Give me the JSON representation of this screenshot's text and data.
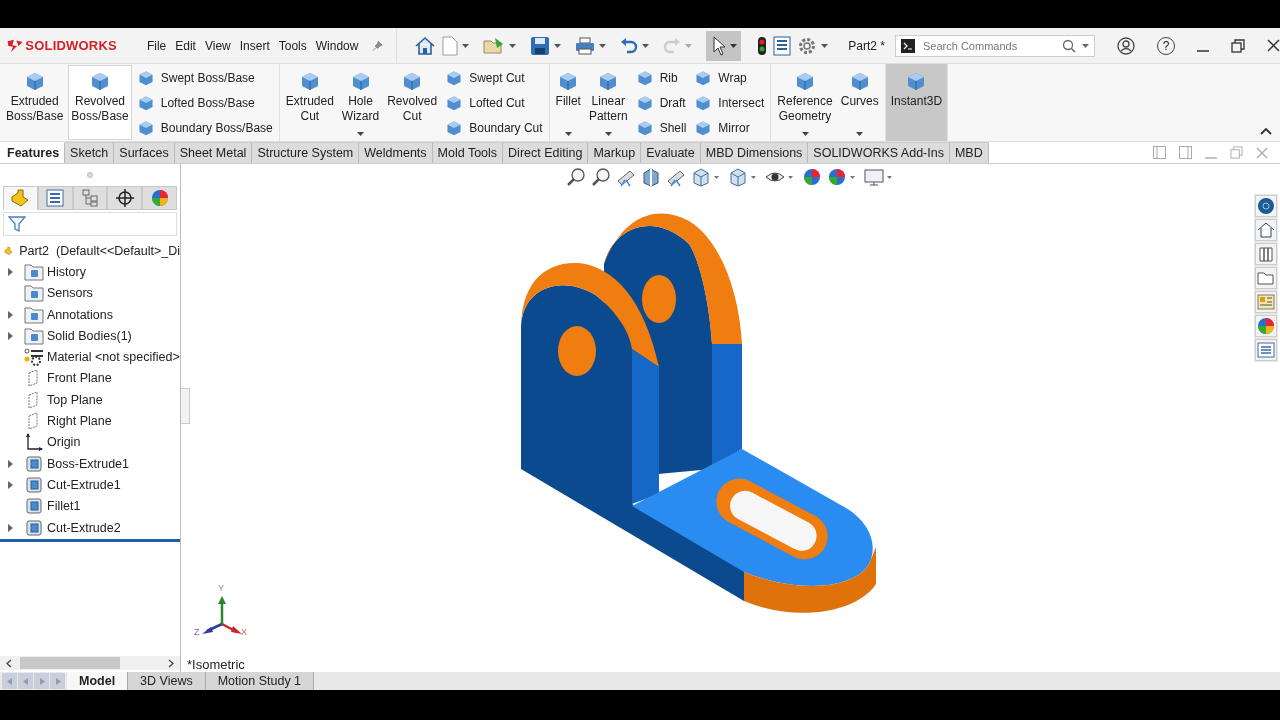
{
  "app": {
    "logo": "SOLIDWORKS"
  },
  "menu": [
    {
      "label": "File"
    },
    {
      "label": "Edit"
    },
    {
      "label": "View"
    },
    {
      "label": "Insert"
    },
    {
      "label": "Tools"
    },
    {
      "label": "Window"
    }
  ],
  "document_title": "Part2 *",
  "search": {
    "placeholder": "Search Commands"
  },
  "help": "?",
  "ribbon": [
    {
      "items": [
        {
          "kind": "large",
          "label": "Extruded Boss/Base",
          "hovered": false,
          "pressed": false,
          "has_menu": false
        },
        {
          "kind": "large",
          "label": "Revolved Boss/Base",
          "hovered": true,
          "pressed": false,
          "has_menu": false
        },
        {
          "kind": "stack",
          "items": [
            {
              "label": "Swept Boss/Base"
            },
            {
              "label": "Lofted Boss/Base"
            },
            {
              "label": "Boundary Boss/Base"
            }
          ]
        }
      ]
    },
    {
      "items": [
        {
          "kind": "large",
          "label": "Extruded Cut",
          "hovered": false,
          "pressed": false,
          "has_menu": false
        },
        {
          "kind": "large",
          "label": "Hole Wizard",
          "hovered": false,
          "pressed": false,
          "has_menu": true
        },
        {
          "kind": "large",
          "label": "Revolved Cut",
          "hovered": false,
          "pressed": false,
          "has_menu": false
        },
        {
          "kind": "stack",
          "items": [
            {
              "label": "Swept Cut"
            },
            {
              "label": "Lofted Cut"
            },
            {
              "label": "Boundary Cut"
            }
          ]
        }
      ]
    },
    {
      "items": [
        {
          "kind": "large",
          "label": "Fillet",
          "hovered": false,
          "pressed": false,
          "has_menu": true
        },
        {
          "kind": "large",
          "label": "Linear Pattern",
          "hovered": false,
          "pressed": false,
          "has_menu": true
        },
        {
          "kind": "stack",
          "items": [
            {
              "label": "Rib"
            },
            {
              "label": "Draft"
            },
            {
              "label": "Shell"
            }
          ]
        },
        {
          "kind": "stack",
          "items": [
            {
              "label": "Wrap"
            },
            {
              "label": "Intersect"
            },
            {
              "label": "Mirror"
            }
          ]
        }
      ]
    },
    {
      "items": [
        {
          "kind": "large",
          "label": "Reference Geometry",
          "hovered": false,
          "pressed": false,
          "has_menu": true
        },
        {
          "kind": "large",
          "label": "Curves",
          "hovered": false,
          "pressed": false,
          "has_menu": true
        }
      ]
    },
    {
      "items": [
        {
          "kind": "large",
          "label": "Instant3D",
          "hovered": false,
          "pressed": true,
          "has_menu": false
        }
      ]
    }
  ],
  "tabs": [
    {
      "label": "Features",
      "selected": true
    },
    {
      "label": "Sketch",
      "selected": false
    },
    {
      "label": "Surfaces",
      "selected": false
    },
    {
      "label": "Sheet Metal",
      "selected": false
    },
    {
      "label": "Structure System",
      "selected": false
    },
    {
      "label": "Weldments",
      "selected": false
    },
    {
      "label": "Mold Tools",
      "selected": false
    },
    {
      "label": "Direct Editing",
      "selected": false
    },
    {
      "label": "Markup",
      "selected": false
    },
    {
      "label": "Evaluate",
      "selected": false
    },
    {
      "label": "MBD Dimensions",
      "selected": false
    },
    {
      "label": "SOLIDWORKS Add-Ins",
      "selected": false
    },
    {
      "label": "MBD",
      "selected": false
    }
  ],
  "panel_tabs": [
    {
      "selected": true
    },
    {
      "selected": false
    },
    {
      "selected": false
    },
    {
      "selected": false
    },
    {
      "selected": false
    }
  ],
  "tree": {
    "root": "Part2  (Default<<Default>_Di",
    "items": [
      {
        "label": "History",
        "kind": "folder",
        "has_children": true
      },
      {
        "label": "Sensors",
        "kind": "folder",
        "has_children": false
      },
      {
        "label": "Annotations",
        "kind": "folder",
        "has_children": true
      },
      {
        "label": "Solid Bodies(1)",
        "kind": "folder",
        "has_children": true
      },
      {
        "label": "Material <not specified>",
        "kind": "material",
        "has_children": false
      },
      {
        "label": "Front Plane",
        "kind": "plane",
        "has_children": false
      },
      {
        "label": "Top Plane",
        "kind": "plane",
        "has_children": false
      },
      {
        "label": "Right Plane",
        "kind": "plane",
        "has_children": false
      },
      {
        "label": "Origin",
        "kind": "origin",
        "has_children": false
      },
      {
        "label": "Boss-Extrude1",
        "kind": "feature",
        "has_children": true
      },
      {
        "label": "Cut-Extrude1",
        "kind": "feature",
        "has_children": true
      },
      {
        "label": "Fillet1",
        "kind": "feature",
        "has_children": false
      },
      {
        "label": "Cut-Extrude2",
        "kind": "feature",
        "has_children": true
      }
    ]
  },
  "triad": {
    "x": "X",
    "y": "Y",
    "z": "Z"
  },
  "view_label": "*Isometric",
  "bottom_tabs": [
    {
      "label": "Model",
      "selected": true
    },
    {
      "label": "3D Views",
      "selected": false
    },
    {
      "label": "Motion Study 1",
      "selected": false
    }
  ]
}
